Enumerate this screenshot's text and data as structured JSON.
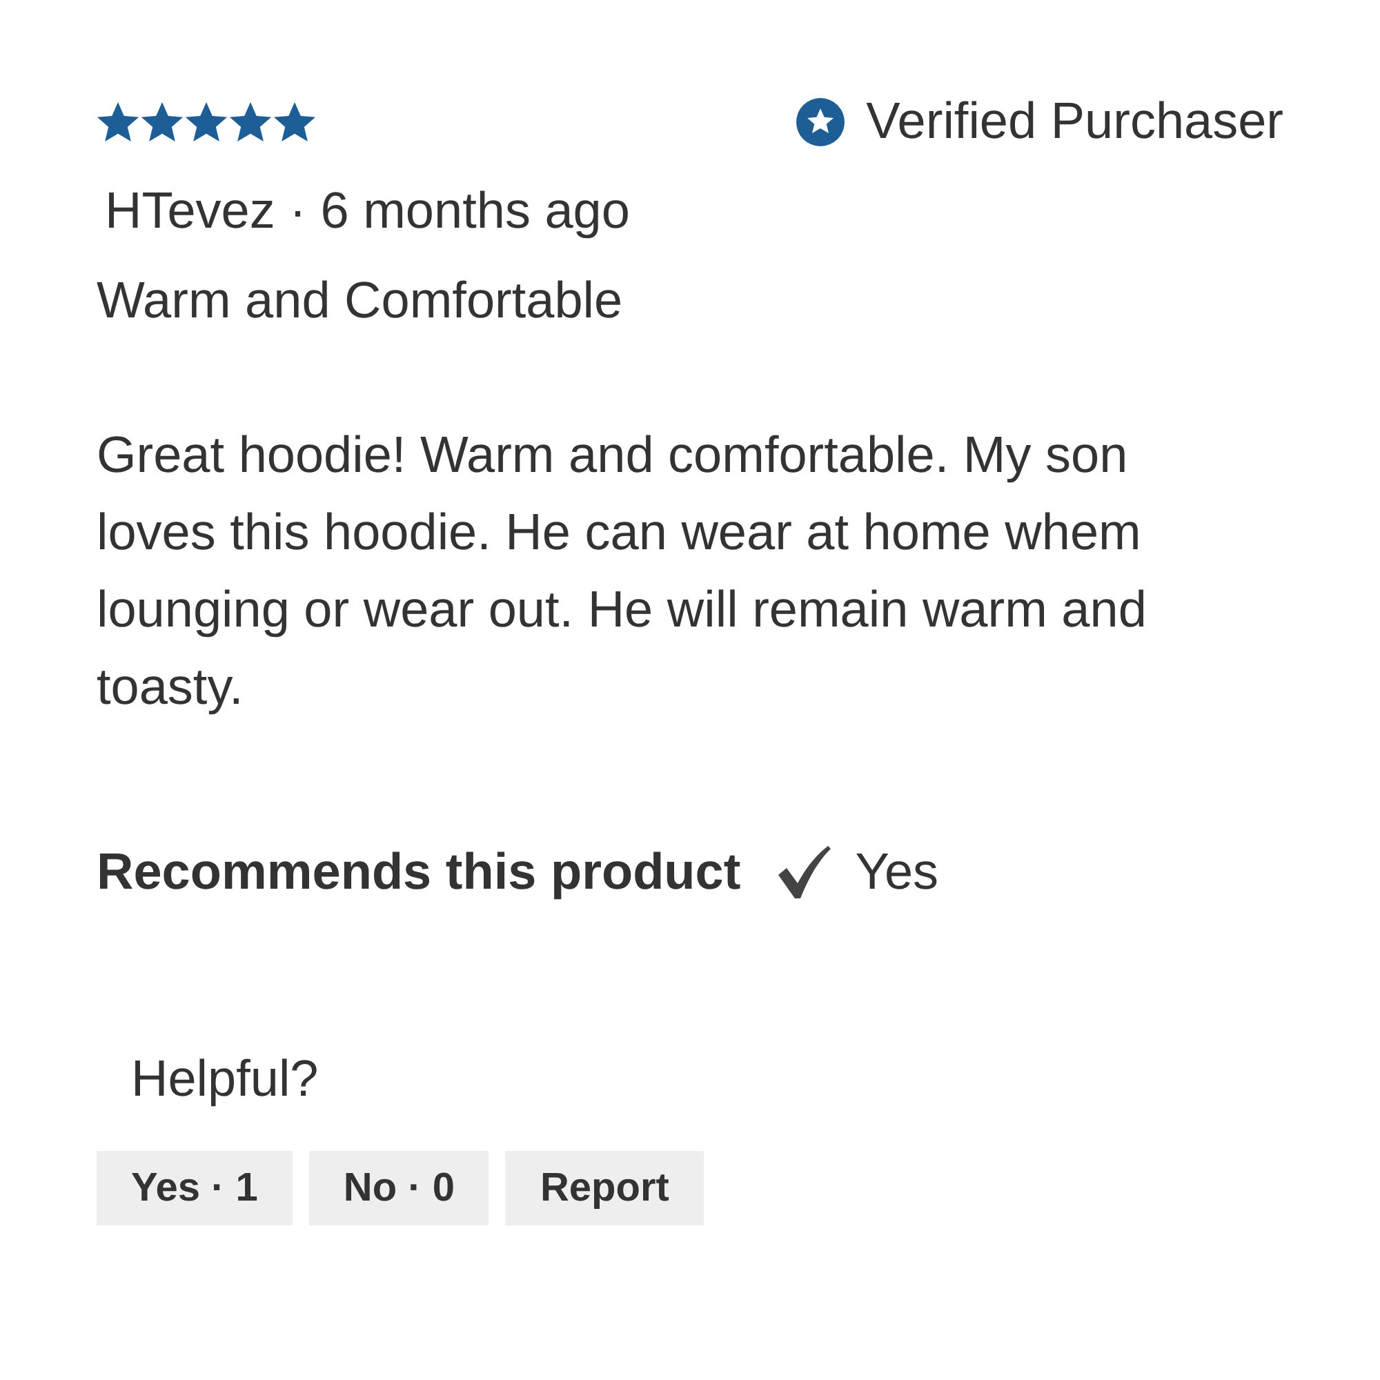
{
  "review": {
    "stars": 5,
    "verified": {
      "label": "Verified Purchaser"
    },
    "byline": "HTevez · 6 months ago",
    "title": "Warm and Comfortable",
    "body": "Great hoodie! Warm and comfortable. My son loves this hoodie. He can wear at home whem lounging or wear out. He will remain warm and toasty.",
    "recommends": {
      "label": "Recommends this product",
      "checked": true,
      "answer": "Yes"
    }
  },
  "helpful": {
    "label": "Helpful?",
    "buttons": [
      {
        "label": "Yes · 1"
      },
      {
        "label": "No · 0"
      },
      {
        "label": "Report"
      }
    ]
  }
}
